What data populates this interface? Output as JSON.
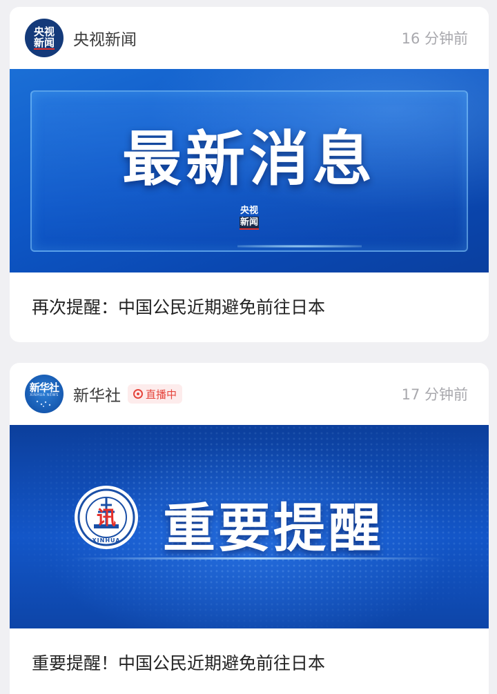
{
  "feed": [
    {
      "source": "央视新闻",
      "avatar_line1": "央视",
      "avatar_line2": "新闻",
      "time": "16 分钟前",
      "banner_title": "最新消息",
      "banner_logo_line1": "央视",
      "banner_logo_line2": "新闻",
      "headline": "再次提醒：中国公民近期避免前往日本"
    },
    {
      "source": "新华社",
      "avatar_name": "新华社",
      "avatar_sub": "XINHUA NEWS",
      "live_label": "直播中",
      "time": "17 分钟前",
      "banner_title": "重要提醒",
      "emblem_char": "讯",
      "emblem_ring": "XINHUA",
      "headline": "重要提醒！中国公民近期避免前往日本"
    }
  ],
  "colors": {
    "background": "#f0f0f3",
    "card": "#ffffff",
    "cctv_blue": "#143a7a",
    "banner_blue": "#0e58c7",
    "live_red": "#e5453c",
    "timestamp_gray": "#a8a8ad"
  }
}
